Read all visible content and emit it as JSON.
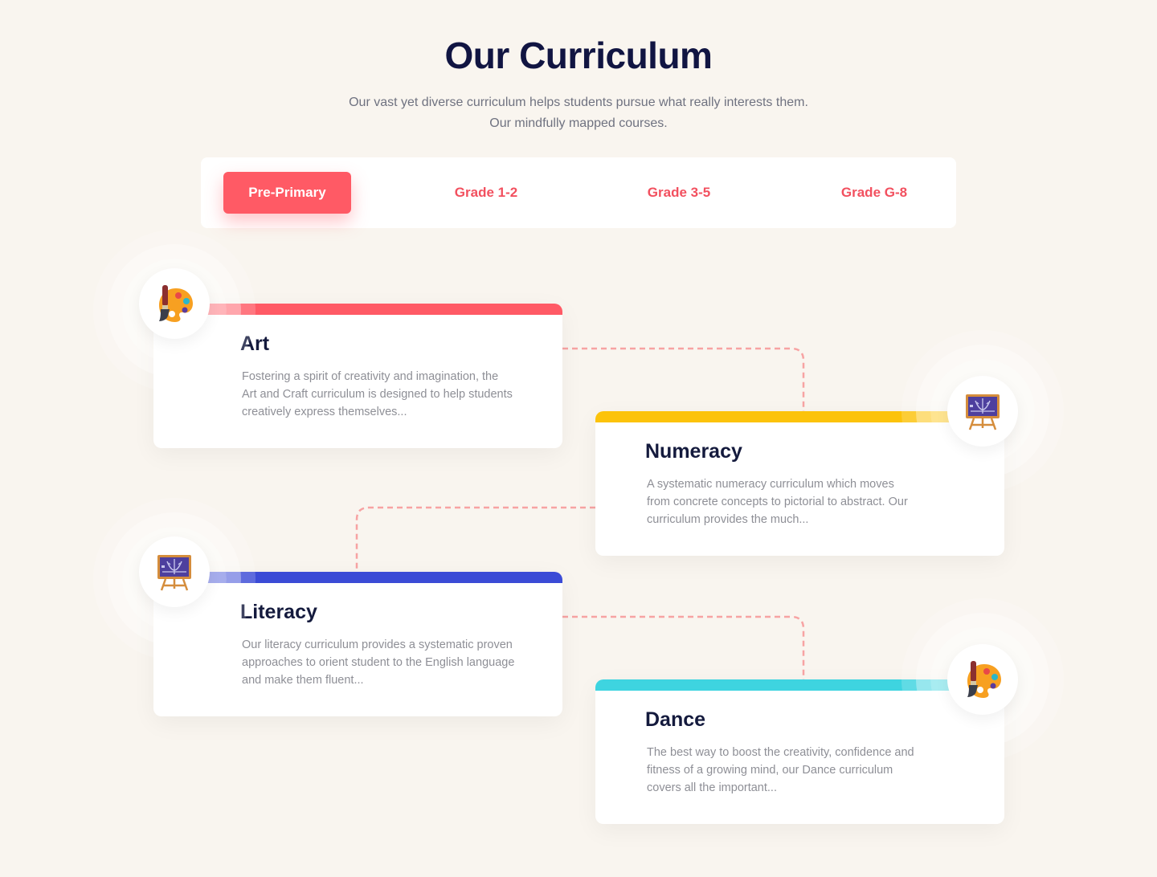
{
  "header": {
    "title": "Our Curriculum",
    "subtitle": "Our vast yet diverse curriculum helps students pursue what really interests them. Our mindfully mapped courses."
  },
  "tabs": [
    {
      "label": "Pre-Primary",
      "active": true
    },
    {
      "label": "Grade 1-2",
      "active": false
    },
    {
      "label": "Grade 3-5",
      "active": false
    },
    {
      "label": "Grade G-8",
      "active": false
    }
  ],
  "courses": [
    {
      "title": "Art",
      "description": "Fostering a spirit of creativity and imagination, the Art and Craft curriculum is designed to help students creatively express themselves...",
      "accent": "#ff5a65",
      "icon": "palette-icon"
    },
    {
      "title": "Numeracy",
      "description": "A systematic numeracy curriculum which moves from concrete concepts to pictorial to abstract. Our curriculum provides the much...",
      "accent": "#fcc30b",
      "icon": "chalkboard-icon"
    },
    {
      "title": "Literacy",
      "description": "Our literacy curriculum provides a systematic proven approaches to orient student to the English language and make them fluent...",
      "accent": "#3b4bd6",
      "icon": "chalkboard-icon"
    },
    {
      "title": "Dance",
      "description": "The best way to boost the creativity, confidence and fitness of a growing mind, our Dance curriculum covers all the important...",
      "accent": "#3ed4e0",
      "icon": "palette-icon"
    }
  ],
  "colors": {
    "background": "#f9f5ef",
    "primary": "#ff5a65",
    "connector": "#f7a3a3"
  }
}
